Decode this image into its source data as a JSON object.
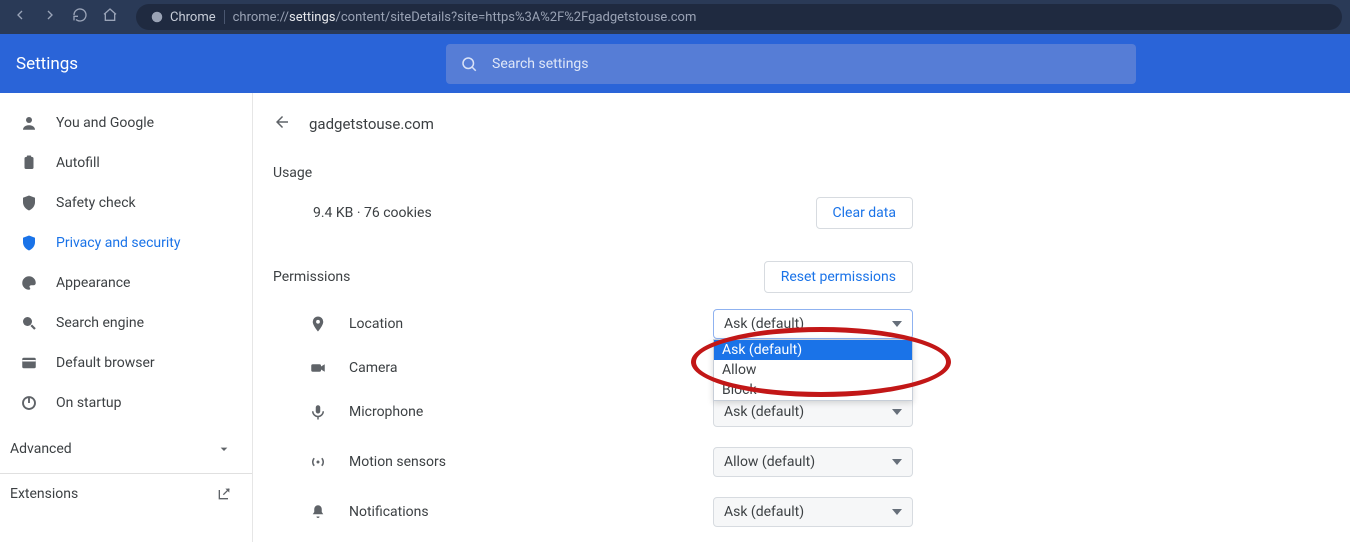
{
  "browser": {
    "chip_label": "Chrome",
    "url_prefix": "chrome://",
    "url_strong": "settings",
    "url_rest": "/content/siteDetails?site=https%3A%2F%2Fgadgetstouse.com"
  },
  "header": {
    "title": "Settings",
    "search_placeholder": "Search settings"
  },
  "sidebar": {
    "items": [
      {
        "label": "You and Google"
      },
      {
        "label": "Autofill"
      },
      {
        "label": "Safety check"
      },
      {
        "label": "Privacy and security"
      },
      {
        "label": "Appearance"
      },
      {
        "label": "Search engine"
      },
      {
        "label": "Default browser"
      },
      {
        "label": "On startup"
      }
    ],
    "advanced_label": "Advanced",
    "extensions_label": "Extensions"
  },
  "panel": {
    "site": "gadgetstouse.com",
    "usage_label": "Usage",
    "usage_value": "9.4 KB · 76 cookies",
    "clear_label": "Clear data",
    "permissions_label": "Permissions",
    "reset_label": "Reset permissions",
    "rows": [
      {
        "name": "Location",
        "value": "Ask (default)"
      },
      {
        "name": "Camera",
        "value": ""
      },
      {
        "name": "Microphone",
        "value": "Ask (default)"
      },
      {
        "name": "Motion sensors",
        "value": "Allow (default)"
      },
      {
        "name": "Notifications",
        "value": "Ask (default)"
      }
    ],
    "dropdown_options": [
      "Ask (default)",
      "Allow",
      "Block"
    ]
  }
}
